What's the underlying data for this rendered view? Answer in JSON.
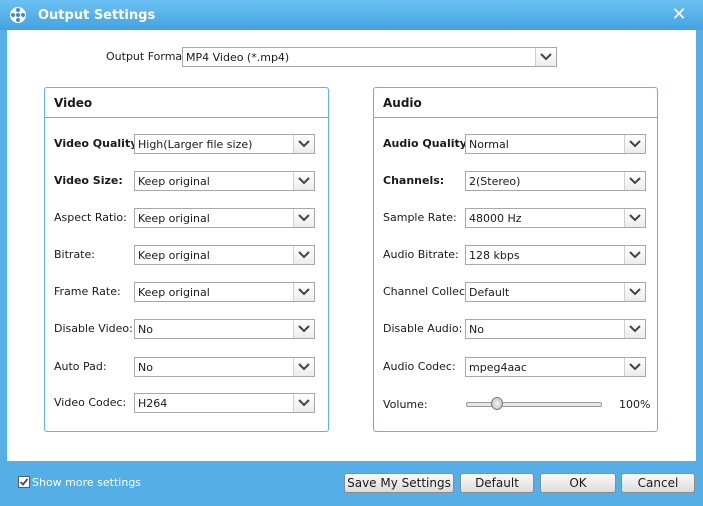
{
  "window": {
    "title": "Output Settings",
    "close_glyph": "✕"
  },
  "output_format": {
    "label": "Output Format:",
    "value": "MP4 Video (*.mp4)"
  },
  "video": {
    "header": "Video",
    "rows": [
      {
        "label": "Video Quality:",
        "value": "High(Larger file size)"
      },
      {
        "label": "Video Size:",
        "value": "Keep original"
      },
      {
        "label": "Aspect Ratio:",
        "value": "Keep original"
      },
      {
        "label": "Bitrate:",
        "value": "Keep original"
      },
      {
        "label": "Frame Rate:",
        "value": "Keep original"
      },
      {
        "label": "Disable Video:",
        "value": "No"
      },
      {
        "label": "Auto Pad:",
        "value": "No"
      },
      {
        "label": "Video Codec:",
        "value": "H264"
      }
    ]
  },
  "audio": {
    "header": "Audio",
    "rows": [
      {
        "label": "Audio Quality:",
        "value": "Normal"
      },
      {
        "label": "Channels:",
        "value": "2(Stereo)"
      },
      {
        "label": "Sample Rate:",
        "value": "48000 Hz"
      },
      {
        "label": "Audio Bitrate:",
        "value": "128 kbps"
      },
      {
        "label": "Channel Collect:",
        "value": "Default"
      },
      {
        "label": "Disable Audio:",
        "value": "No"
      },
      {
        "label": "Audio Codec:",
        "value": "mpeg4aac"
      }
    ],
    "volume": {
      "label": "Volume:",
      "display": "100%",
      "level_fraction": 0.2
    }
  },
  "footer": {
    "show_more_label": "Show more settings",
    "show_more_checked": true,
    "save_label": "Save My Settings",
    "default_label": "Default",
    "ok_label": "OK",
    "cancel_label": "Cancel"
  },
  "icons": {
    "title": "film-reel-icon",
    "dropdown": "chevron-down-icon",
    "check": "checkmark-icon"
  },
  "colors": {
    "frame": "#55aee6",
    "group_border": "#5fb3e6",
    "title_text": "#ffffff"
  }
}
